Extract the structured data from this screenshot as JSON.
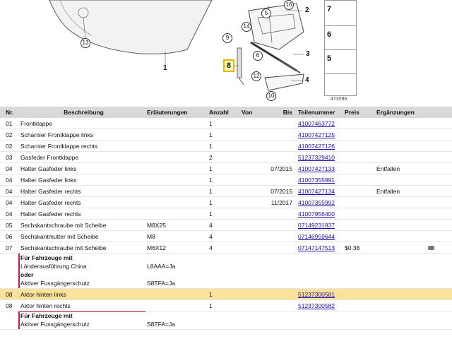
{
  "diagram": {
    "callouts": [
      "13",
      "1",
      "9",
      "14",
      "6",
      "5",
      "16",
      "2",
      "3",
      "8",
      "12",
      "4",
      "10"
    ],
    "side_panel": [
      "7",
      "6",
      "5"
    ],
    "diagram_id": "473596"
  },
  "table": {
    "headers": {
      "nr": "Nr.",
      "desc": "Beschreibung",
      "erl": "Erläuterungen",
      "anz": "Anzahl",
      "von": "Von",
      "bis": "Bis",
      "part": "Teilenummer",
      "preis": "Preis",
      "erg": "Ergänzungen"
    },
    "rows": [
      {
        "nr": "01",
        "desc": "Frontklappe",
        "erl": "",
        "anz": "1",
        "von": "",
        "bis": "",
        "part": "41007463772",
        "preis": "",
        "erg": ""
      },
      {
        "nr": "02",
        "desc": "Scharnier Frontklappe links",
        "erl": "",
        "anz": "1",
        "von": "",
        "bis": "",
        "part": "41007427125",
        "preis": "",
        "erg": ""
      },
      {
        "nr": "02",
        "desc": "Scharnier Frontklappe rechts",
        "erl": "",
        "anz": "1",
        "von": "",
        "bis": "",
        "part": "41007427126",
        "preis": "",
        "erg": ""
      },
      {
        "nr": "03",
        "desc": "Gasfeder Frontklappe",
        "erl": "",
        "anz": "2",
        "von": "",
        "bis": "",
        "part": "51237329410",
        "preis": "",
        "erg": ""
      },
      {
        "nr": "04",
        "desc": "Halter Gasfeder links",
        "erl": "",
        "anz": "1",
        "von": "",
        "bis": "07/2015",
        "part": "41007427133",
        "preis": "",
        "erg": "Entfallen"
      },
      {
        "nr": "04",
        "desc": "Halter Gasfeder links",
        "erl": "",
        "anz": "1",
        "von": "",
        "bis": "",
        "part": "41007355991",
        "preis": "",
        "erg": ""
      },
      {
        "nr": "04",
        "desc": "Halter Gasfeder rechts",
        "erl": "",
        "anz": "1",
        "von": "",
        "bis": "07/2015",
        "part": "41007427134",
        "preis": "",
        "erg": "Entfallen"
      },
      {
        "nr": "04",
        "desc": "Halter Gasfeder rechts",
        "erl": "",
        "anz": "1",
        "von": "",
        "bis": "11/2017",
        "part": "41007355992",
        "preis": "",
        "erg": ""
      },
      {
        "nr": "04",
        "desc": "Halter Gasfeder rechts",
        "erl": "",
        "anz": "1",
        "von": "",
        "bis": "",
        "part": "41007956400",
        "preis": "",
        "erg": ""
      },
      {
        "nr": "05",
        "desc": "Sechskantschraube mit Scheibe",
        "erl": "M8X25",
        "anz": "4",
        "von": "",
        "bis": "",
        "part": "07149231837",
        "preis": "",
        "erg": ""
      },
      {
        "nr": "06",
        "desc": "Sechskantmutter mit Scheibe",
        "erl": "M8",
        "anz": "4",
        "von": "",
        "bis": "",
        "part": "07146959644",
        "preis": "",
        "erg": ""
      },
      {
        "nr": "07",
        "desc": "Sechskantschraube mit Scheibe",
        "erl": "M6X12",
        "anz": "4",
        "von": "",
        "bis": "",
        "part": "07147147513",
        "preis": "$0.38",
        "erg": ""
      }
    ],
    "cond1": {
      "l1": "Für Fahrzeuge mit",
      "l2": "Länderausführung China",
      "l2_code": "L8AAA=Ja",
      "l3": "oder",
      "l4": "Aktiver Fussgängerschutz",
      "l4_code": "S8TFA=Ja"
    },
    "rows2": [
      {
        "nr": "08",
        "desc": "Aktor hinten links",
        "anz": "1",
        "part": "51237300581"
      },
      {
        "nr": "08",
        "desc": "Aktor hinten rechts",
        "anz": "1",
        "part": "51237300582"
      }
    ],
    "cond2": {
      "l1": "Für Fahrzeuge mit",
      "l2": "Aktiver Fussgängerschutz",
      "l2_code": "S8TFA=Ja"
    }
  }
}
